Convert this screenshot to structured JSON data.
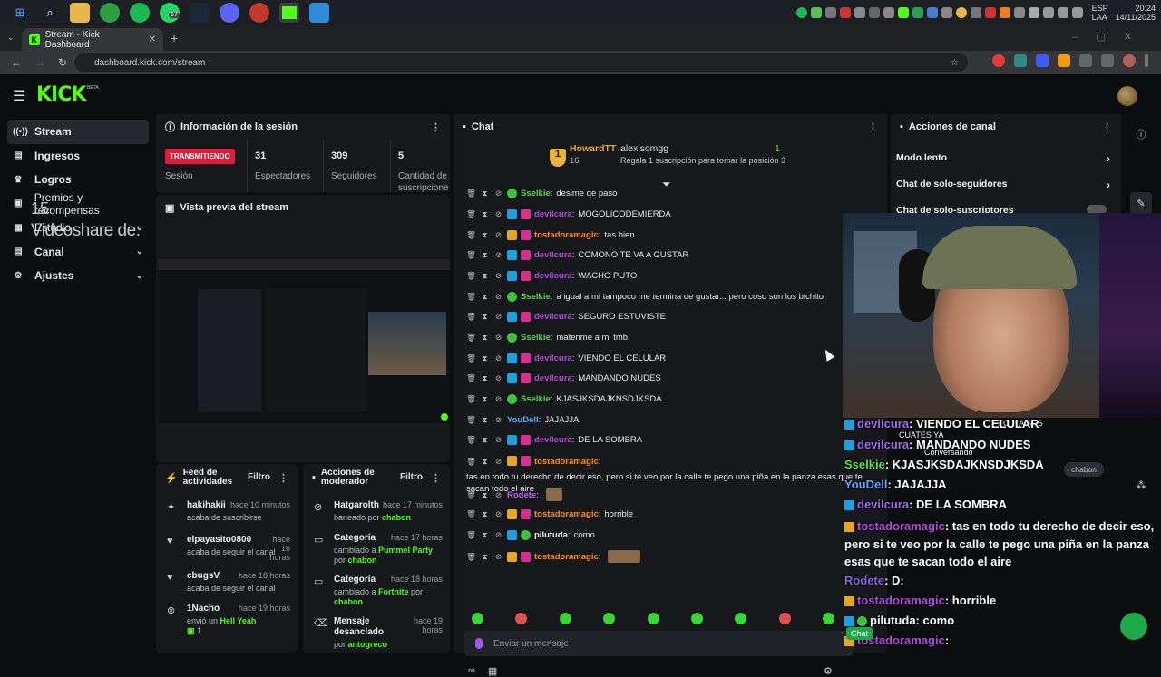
{
  "browser": {
    "tab_title": "Stream - Kick Dashboard",
    "url": "dashboard.kick.com/stream"
  },
  "tray": {
    "lang1": "ESP",
    "lang2": "LAA",
    "time": "20:24",
    "date": "14/11/2025"
  },
  "taskbar": {
    "badge_count": "67"
  },
  "app": {
    "logo": "KICK",
    "beta": "BETA"
  },
  "sidebar": {
    "items": [
      {
        "label": "Stream",
        "icon": "broadcast-icon"
      },
      {
        "label": "Ingresos",
        "icon": "money-icon"
      },
      {
        "label": "Logros",
        "icon": "trophy-icon"
      },
      {
        "label": "Premios y recompensas",
        "icon": "gift-icon"
      },
      {
        "label": "Estudio",
        "icon": "studio-icon"
      },
      {
        "label": "Canal",
        "icon": "channel-icon"
      },
      {
        "label": "Ajustes",
        "icon": "gear-icon"
      }
    ],
    "overlay_number": "15",
    "overlay_text": "Videoshare de:"
  },
  "session": {
    "title": "Información de la sesión",
    "status": "TRANSMITIENDO",
    "status_label": "Sesión",
    "stats": [
      {
        "value": "31",
        "label": "Espectadores"
      },
      {
        "value": "309",
        "label": "Seguidores"
      },
      {
        "value": "5",
        "label": "Cantidad de suscripcione"
      }
    ]
  },
  "preview": {
    "title": "Vista previa del stream"
  },
  "feed": {
    "title": "Feed de actividades",
    "filter": "Filtro",
    "items": [
      {
        "name": "hakihakii",
        "time": "hace 10 minutos",
        "sub": "acaba de suscribirse",
        "icon": "star-icon"
      },
      {
        "name": "elpayasito0800",
        "time": "hace 16 horas",
        "sub": "acaba de seguir el canal",
        "icon": "heart-icon"
      },
      {
        "name": "cbugsV",
        "time": "hace 18 horas",
        "sub": "acaba de seguir el canal",
        "icon": "heart-icon"
      },
      {
        "name": "1Nacho",
        "time": "hace 19 horas",
        "sub_pre": "envió un ",
        "sub_hl": "Hell Yeah",
        "sub2": "1",
        "icon": "kick-icon"
      }
    ]
  },
  "mod": {
    "title": "Acciones de moderador",
    "filter": "Filtro",
    "items": [
      {
        "name": "Hatgarolth",
        "time": "hace 17 minutos",
        "sub_pre": "baneado por ",
        "sub_hl": "chabon",
        "icon": "ban-icon"
      },
      {
        "name": "Categoría",
        "time": "hace 17 horas",
        "sub_pre": "cambiado a ",
        "sub_hl": "Pummel Party",
        "sub_mid": " por ",
        "sub_hl2": "chabon",
        "icon": "category-icon"
      },
      {
        "name": "Categoría",
        "time": "hace 18 horas",
        "sub_pre": "cambiado a ",
        "sub_hl": "Fortnite",
        "sub_mid": " por ",
        "sub_hl2": "chabon",
        "icon": "category-icon"
      },
      {
        "name": "Mensaje desanclado",
        "time": "hace 19 horas",
        "sub_pre": "por ",
        "sub_hl": "antogreco",
        "icon": "unpin-icon"
      }
    ]
  },
  "chat": {
    "title": "Chat",
    "pinned": {
      "rank": "1",
      "user1": "HowardTT",
      "count1": "16",
      "user2": "alexisomgg",
      "sub2": "Regala 1 suscripción para tomar la posición 3",
      "count2": "1"
    },
    "messages": [
      {
        "user": "Sselkie",
        "cls": "u-sselkie",
        "badges": [
          "b-green"
        ],
        "text": "desime qe paso"
      },
      {
        "user": "devilcura",
        "cls": "u-devil",
        "badges": [
          "b-blue",
          "b-pink"
        ],
        "text": "MOGOLICODEMIERDA"
      },
      {
        "user": "tostadoramagic",
        "cls": "u-tost",
        "badges": [
          "b-gold",
          "b-pink"
        ],
        "text": "tas bien"
      },
      {
        "user": "devilcura",
        "cls": "u-devil",
        "badges": [
          "b-blue",
          "b-pink"
        ],
        "text": "COMONO TE VA A GUSTAR"
      },
      {
        "user": "devilcura",
        "cls": "u-devil",
        "badges": [
          "b-blue",
          "b-pink"
        ],
        "text": "WACHO PUTO"
      },
      {
        "user": "Sselkie",
        "cls": "u-sselkie",
        "badges": [
          "b-green"
        ],
        "text": "a igual a mi tampoco me termina de gustar... pero coso son los bichito"
      },
      {
        "user": "devilcura",
        "cls": "u-devil",
        "badges": [
          "b-blue",
          "b-pink"
        ],
        "text": "SEGURO ESTUVISTE"
      },
      {
        "user": "Sselkie",
        "cls": "u-sselkie",
        "badges": [
          "b-green"
        ],
        "text": "matenme a mi tmb"
      },
      {
        "user": "devilcura",
        "cls": "u-devil",
        "badges": [
          "b-blue",
          "b-pink"
        ],
        "text": "VIENDO EL CELULAR"
      },
      {
        "user": "devilcura",
        "cls": "u-devil",
        "badges": [
          "b-blue",
          "b-pink"
        ],
        "text": "MANDANDO NUDES"
      },
      {
        "user": "Sselkie",
        "cls": "u-sselkie",
        "badges": [
          "b-green"
        ],
        "text": "KJASJKSDAJKNSDJKSDA"
      },
      {
        "user": "YouDell",
        "cls": "u-you",
        "badges": [],
        "text": "JAJAJJA"
      },
      {
        "user": "devilcura",
        "cls": "u-devil",
        "badges": [
          "b-blue",
          "b-pink"
        ],
        "text": "DE LA SOMBRA"
      },
      {
        "user": "tostadoramagic",
        "cls": "u-tost",
        "badges": [
          "b-gold",
          "b-pink"
        ],
        "text": "tas en todo tu derecho de decir eso, pero si te veo por la calle te pego una piña en la panza esas que te sacan todo el aire"
      },
      {
        "user": "Rodete",
        "cls": "u-rod",
        "badges": [],
        "text": ""
      },
      {
        "user": "tostadoramagic",
        "cls": "u-tost",
        "badges": [
          "b-gold",
          "b-pink"
        ],
        "text": "horrible"
      },
      {
        "user": "pilutuda",
        "cls": "u-pil",
        "badges": [
          "b-blue",
          "b-green"
        ],
        "text": "como"
      },
      {
        "user": "tostadoramagic",
        "cls": "u-tost",
        "badges": [
          "b-gold",
          "b-pink"
        ],
        "text": ""
      }
    ],
    "input_placeholder": "Enviar un mensaje"
  },
  "actions": {
    "title": "Acciones de canal",
    "items": [
      {
        "label": "Modo lento"
      },
      {
        "label": "Chat de solo-seguidores"
      },
      {
        "label": "Chat de solo-suscriptores"
      }
    ]
  },
  "overlay_chat": {
    "lines": [
      {
        "user": "devilcura",
        "text": "VIENDO EL CELULAR"
      },
      {
        "user": "devilcura",
        "text": "MANDANDO NUDES"
      },
      {
        "user": "Sselkie",
        "text": "KJASJKSDAJKNSDJKSDA"
      },
      {
        "user": "YouDell",
        "text": "JAJAJJA"
      },
      {
        "user": "devilcura",
        "text": "DE LA SOMBRA"
      }
    ],
    "tost_user": "tostadoramagic",
    "tost_text": "tas en todo tu derecho de decir eso, pero si te veo por la calle te pego una piña en la panza esas que te sacan todo el aire",
    "rodete_user": "Rodete",
    "rodete_text": "D:",
    "tost2_user": "tostadoramagic",
    "tost2_text": "horrible",
    "pil_user": "pilutuda",
    "pil_text": "como",
    "tost3_user": "tostadoramagic",
    "notif_line1": "CUATES YA",
    "notif_line2": "Conversando",
    "notif_bg": "EO Y A SUS",
    "chip": "chabon",
    "chat_btn": "Chat"
  }
}
